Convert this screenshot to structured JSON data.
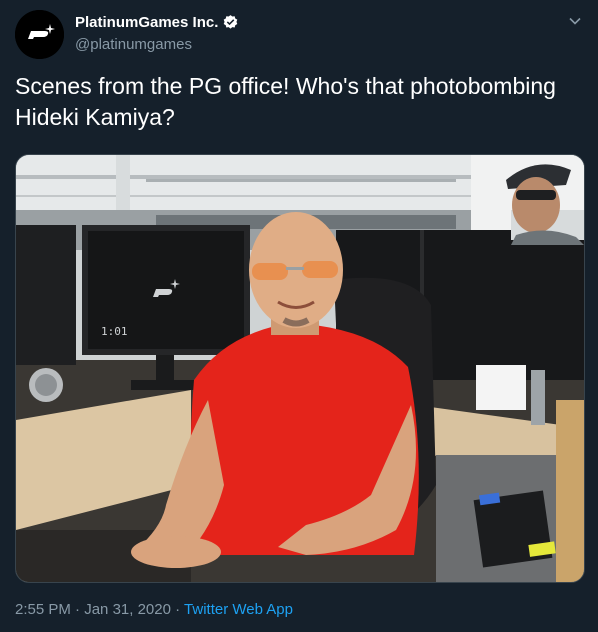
{
  "author": {
    "display_name": "PlatinumGames Inc.",
    "handle": "@platinumgames",
    "verified": true,
    "avatar_icon": "platinumgames-logo-icon"
  },
  "tweet": {
    "text": "Scenes from the PG office! Who's that photobombing Hideki Kamiya?",
    "time": "2:55 PM",
    "separator": "·",
    "date": "Jan 31, 2020",
    "app": "Twitter Web App"
  },
  "photo": {
    "monitor_clock": "1:01"
  },
  "colors": {
    "background": "#15202b",
    "secondary_text": "#8899a6",
    "link": "#1da1f2"
  }
}
